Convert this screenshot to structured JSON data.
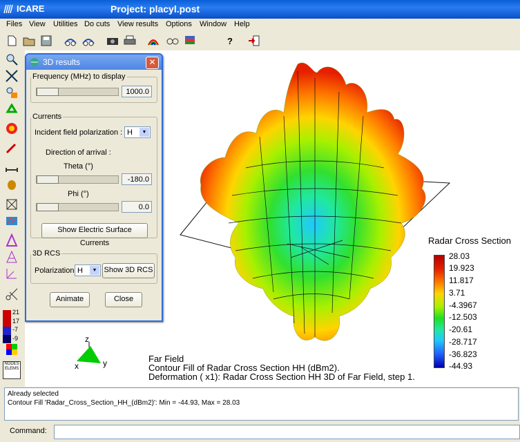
{
  "window": {
    "app_title": "ICARE",
    "project_title": "Project: placyl.post"
  },
  "menu": [
    "Files",
    "View",
    "Utilities",
    "Do cuts",
    "View results",
    "Options",
    "Window",
    "Help"
  ],
  "toolbar_icons": [
    "new-icon",
    "open-folder-icon",
    "save-icon",
    "view-rotate-left-icon",
    "view-rotate-right-icon",
    "camera-icon",
    "printer-icon",
    "rainbow-icon",
    "glasses-icon",
    "layers-icon",
    "help-icon",
    "exit-icon"
  ],
  "left_toolbar_icons": [
    "zoom-in-icon",
    "zoom-fit-icon",
    "zoom-box-icon",
    "recycle-icon",
    "color-shade-icon",
    "pointer-icon",
    "measure-icon",
    "light-icon",
    "wire-cube-icon",
    "plot-icon",
    "triangle-icon",
    "triangle-outline-icon",
    "axes-icon",
    "scissors-icon"
  ],
  "dialog": {
    "title": "3D results",
    "frequency": {
      "label": "Frequency (MHz) to display",
      "value": "1000.0"
    },
    "currents": {
      "legend": "Currents",
      "polarization_label": "Incident field polarization :",
      "polarization_value": "H",
      "direction_label": "Direction of arrival :",
      "theta_label": "Theta (°)",
      "theta_value": "-180.0",
      "phi_label": "Phi (°)",
      "phi_value": "0.0",
      "show_currents_button": "Show Electric Surface Currents"
    },
    "rcs": {
      "legend": "3D RCS",
      "polarization_label": "Polarization",
      "polarization_value": "H",
      "show_button": "Show 3D RCS"
    },
    "animate_button": "Animate",
    "close_button": "Close"
  },
  "left_mini_legend": [
    "21",
    "17",
    "-7",
    "-9"
  ],
  "left_mini_label": "NODES ELEMS",
  "viewport": {
    "legend_title": "Radar Cross Section",
    "legend_values": [
      "28.03",
      "19.923",
      "11.817",
      "3.71",
      "-4.3967",
      "-12.503",
      "-20.61",
      "-28.717",
      "-36.823",
      "-44.93"
    ],
    "caption_line1": "Far Field",
    "caption_line2": "Contour Fill of Radar Cross Section HH (dBm2).",
    "caption_line3": "Deformation ( x1): Radar Cross Section HH 3D of Far Field, step 1.",
    "axis_z": "z",
    "axis_x": "x",
    "axis_y": "y"
  },
  "status": {
    "line1": "Already selected",
    "line2": "Contour Fill 'Radar_Cross_Section_HH_(dBm2)': Min = -44.93, Max = 28.03"
  },
  "command": {
    "label": "Command:",
    "value": ""
  },
  "colors": {
    "titlebar": "#0a5fd8",
    "dialog_border": "#2a6ce0",
    "viewport_bg": "#ffffff"
  }
}
